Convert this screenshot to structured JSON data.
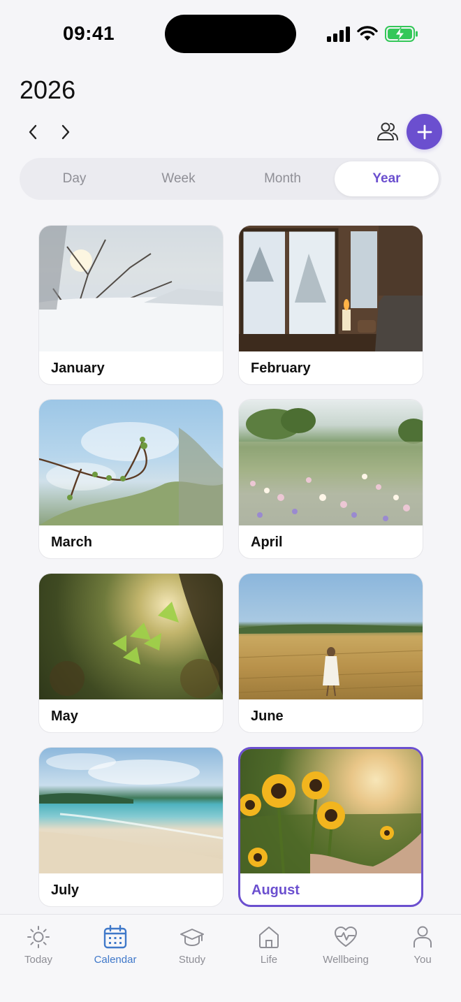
{
  "status_bar": {
    "time": "09:41"
  },
  "header": {
    "year": "2026"
  },
  "view_tabs": [
    "Day",
    "Week",
    "Month",
    "Year"
  ],
  "selected_view": "Year",
  "months": [
    {
      "label": "January"
    },
    {
      "label": "February"
    },
    {
      "label": "March"
    },
    {
      "label": "April"
    },
    {
      "label": "May"
    },
    {
      "label": "June"
    },
    {
      "label": "July"
    },
    {
      "label": "August"
    }
  ],
  "selected_month": "August",
  "tabbar": {
    "items": [
      {
        "label": "Today",
        "icon": "sun-icon"
      },
      {
        "label": "Calendar",
        "icon": "calendar-icon"
      },
      {
        "label": "Study",
        "icon": "graduation-cap-icon"
      },
      {
        "label": "Life",
        "icon": "home-icon"
      },
      {
        "label": "Wellbeing",
        "icon": "heart-pulse-icon"
      },
      {
        "label": "You",
        "icon": "person-icon"
      }
    ],
    "active": "Calendar"
  },
  "colors": {
    "accent": "#6b4fcf",
    "tab_active": "#3f78c9",
    "battery": "#34c759"
  }
}
